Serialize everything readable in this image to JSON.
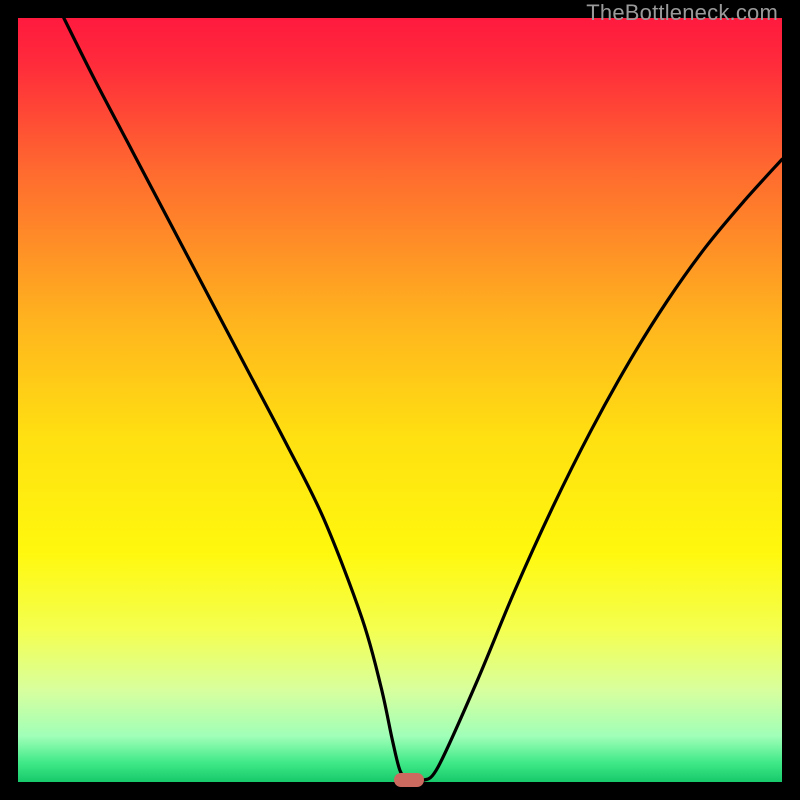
{
  "watermark": "TheBottleneck.com",
  "chart_data": {
    "type": "line",
    "title": "",
    "xlabel": "",
    "ylabel": "",
    "xlim": [
      0,
      100
    ],
    "ylim": [
      0,
      100
    ],
    "series": [
      {
        "name": "bottleneck-curve",
        "x": [
          6,
          10,
          15,
          20,
          25,
          30,
          35,
          40,
          45,
          47.5,
          49,
          50,
          51,
          52,
          53,
          55,
          60,
          65,
          70,
          75,
          80,
          85,
          90,
          95,
          100
        ],
        "values": [
          100,
          92,
          82.5,
          73,
          63.5,
          54,
          44.5,
          34.5,
          21.5,
          12.5,
          5.5,
          1.5,
          0.4,
          0.2,
          0.2,
          2,
          13,
          25,
          36,
          46,
          55,
          63,
          70,
          76,
          81.5
        ]
      }
    ],
    "marker": {
      "x": 51.2,
      "y": 0.25,
      "color": "#cc6a5f"
    },
    "gradient_stops": [
      {
        "offset": 0.0,
        "color": "#ff1a3e"
      },
      {
        "offset": 0.06,
        "color": "#ff2b3b"
      },
      {
        "offset": 0.2,
        "color": "#ff6a2f"
      },
      {
        "offset": 0.4,
        "color": "#ffb51e"
      },
      {
        "offset": 0.55,
        "color": "#ffe011"
      },
      {
        "offset": 0.7,
        "color": "#fff80e"
      },
      {
        "offset": 0.8,
        "color": "#f4ff4f"
      },
      {
        "offset": 0.88,
        "color": "#d8ff9e"
      },
      {
        "offset": 0.94,
        "color": "#a0ffb8"
      },
      {
        "offset": 0.975,
        "color": "#3fe987"
      },
      {
        "offset": 1.0,
        "color": "#17c96b"
      }
    ]
  }
}
